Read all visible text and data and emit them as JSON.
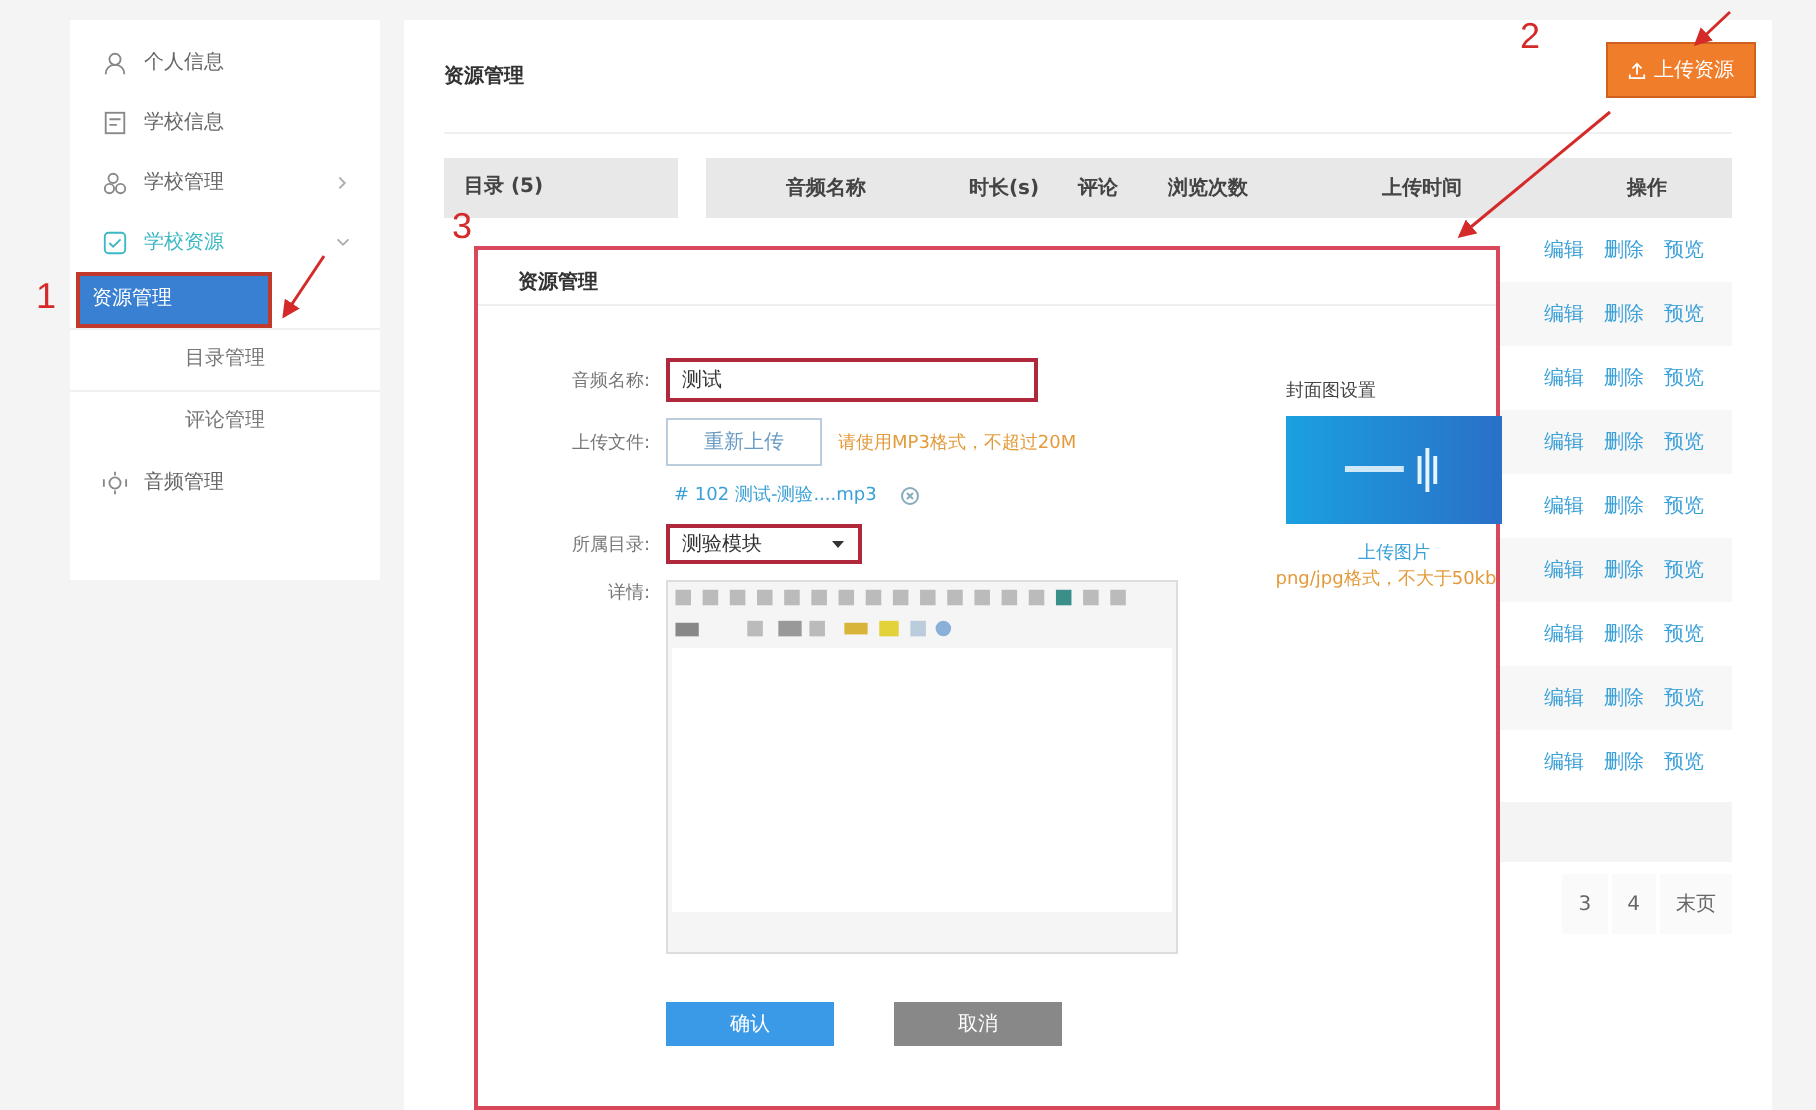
{
  "sidebar": {
    "items": [
      {
        "label": "个人信息",
        "kind": "link",
        "selected": false
      },
      {
        "label": "学校信息",
        "kind": "link",
        "selected": false
      },
      {
        "label": "学校管理",
        "kind": "group",
        "selected": false,
        "expanded": false
      },
      {
        "label": "学校资源",
        "kind": "group",
        "selected": true,
        "expanded": true,
        "children": [
          {
            "label": "资源管理",
            "selected": true
          },
          {
            "label": "目录管理",
            "selected": false
          },
          {
            "label": "评论管理",
            "selected": false
          }
        ]
      },
      {
        "label": "音频管理",
        "kind": "link",
        "selected": false
      }
    ]
  },
  "page": {
    "title": "资源管理",
    "upload_button": "上传资源"
  },
  "directory": {
    "header": "目录 (5)"
  },
  "table": {
    "columns": [
      "音频名称",
      "时长(s)",
      "评论",
      "浏览次数",
      "上传时间",
      "操作"
    ],
    "rows": [
      {
        "actions": [
          "编辑",
          "删除",
          "预览"
        ]
      },
      {
        "actions": [
          "编辑",
          "删除",
          "预览"
        ]
      },
      {
        "actions": [
          "编辑",
          "删除",
          "预览"
        ]
      },
      {
        "actions": [
          "编辑",
          "删除",
          "预览"
        ]
      },
      {
        "actions": [
          "编辑",
          "删除",
          "预览"
        ]
      },
      {
        "actions": [
          "编辑",
          "删除",
          "预览"
        ]
      },
      {
        "actions": [
          "编辑",
          "删除",
          "预览"
        ]
      },
      {
        "actions": [
          "编辑",
          "删除",
          "预览"
        ]
      },
      {
        "actions": [
          "编辑",
          "删除",
          "预览"
        ]
      }
    ]
  },
  "pagination": [
    "3",
    "4",
    "末页"
  ],
  "dialog": {
    "title": "资源管理",
    "name_label": "音频名称:",
    "name_value": "测试",
    "file_label": "上传文件:",
    "reupload_button": "重新上传",
    "file_hint": "请使用MP3格式，不超过20M",
    "file_name": "# 102 测试-测验....mp3",
    "dir_label": "所属目录:",
    "dir_value": "测验模块",
    "detail_label": "详情:",
    "cover_label": "封面图设置",
    "cover_upload": "上传图片",
    "cover_hint": "png/jpg格式，不大于50kb",
    "confirm_button": "确认",
    "cancel_button": "取消"
  },
  "annotations": [
    {
      "label": "1"
    },
    {
      "label": "2"
    },
    {
      "label": "3"
    }
  ]
}
